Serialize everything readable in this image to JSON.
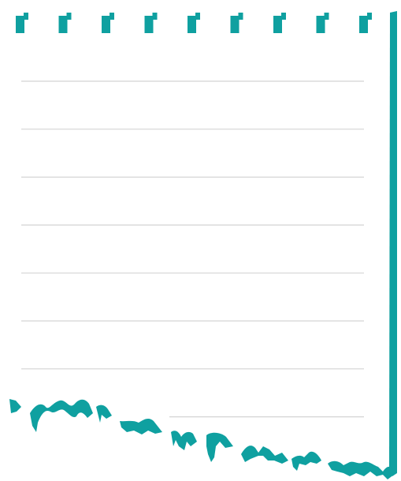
{
  "notepad": {
    "colors": {
      "accent": "#0fa0a0",
      "rule_line": "#d4d4d4",
      "paper": "#ffffff"
    },
    "ruled_line_count": 8,
    "binding_hole_count": 9,
    "torn_edge": true
  }
}
